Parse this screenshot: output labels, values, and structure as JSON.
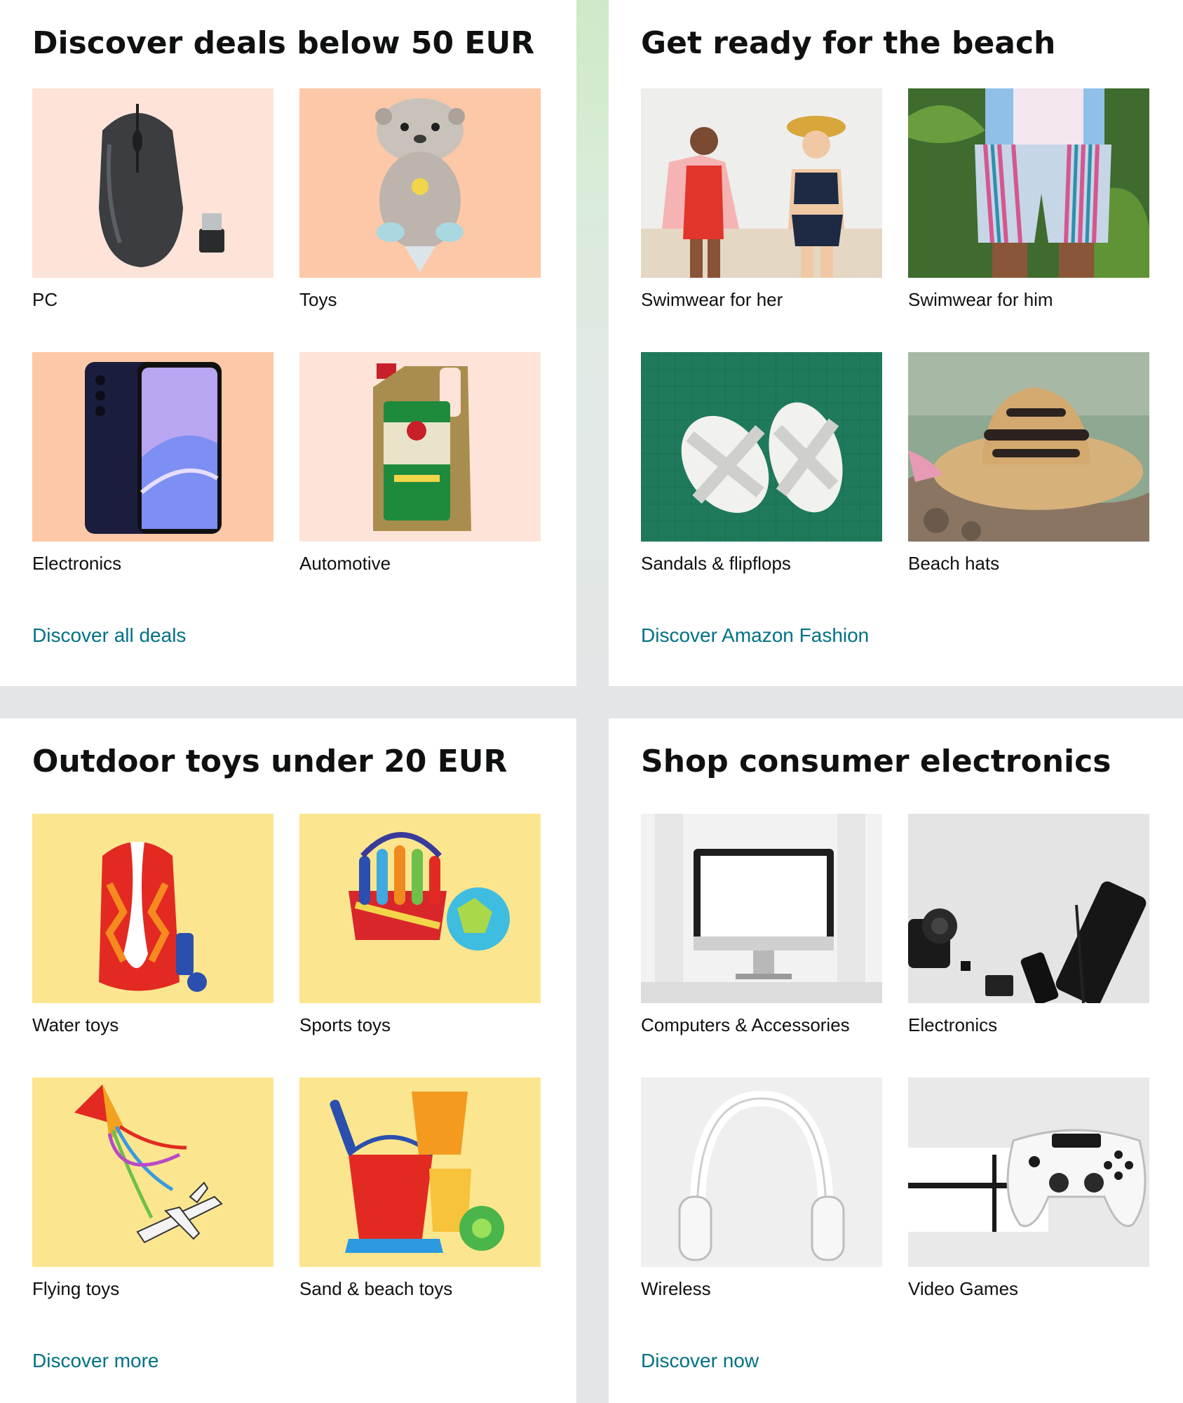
{
  "cards": [
    {
      "title": "Discover deals below 50 EUR",
      "link": "Discover all deals",
      "items": [
        {
          "label": "PC",
          "icon": "mouse-icon"
        },
        {
          "label": "Toys",
          "icon": "plush-toy-icon"
        },
        {
          "label": "Electronics",
          "icon": "smartphone-icon"
        },
        {
          "label": "Automotive",
          "icon": "motor-oil-icon"
        }
      ]
    },
    {
      "title": "Get ready for the beach",
      "link": "Discover Amazon Fashion",
      "items": [
        {
          "label": "Swimwear for her",
          "icon": "swimwear-her-icon"
        },
        {
          "label": "Swimwear for him",
          "icon": "swim-shorts-icon"
        },
        {
          "label": "Sandals & flipflops",
          "icon": "sandals-icon"
        },
        {
          "label": "Beach hats",
          "icon": "sun-hat-icon"
        }
      ]
    },
    {
      "title": "Outdoor toys under 20 EUR",
      "link": "Discover more",
      "items": [
        {
          "label": "Water toys",
          "icon": "bodyboard-icon"
        },
        {
          "label": "Sports toys",
          "icon": "bowling-set-icon"
        },
        {
          "label": "Flying toys",
          "icon": "kite-icon"
        },
        {
          "label": "Sand & beach toys",
          "icon": "sand-bucket-icon"
        }
      ]
    },
    {
      "title": "Shop consumer electronics",
      "link": "Discover now",
      "items": [
        {
          "label": "Computers & Accessories",
          "icon": "desktop-monitor-icon"
        },
        {
          "label": "Electronics",
          "icon": "camera-phone-icon"
        },
        {
          "label": "Wireless",
          "icon": "headphones-icon"
        },
        {
          "label": "Video Games",
          "icon": "game-controller-icon"
        }
      ]
    }
  ]
}
